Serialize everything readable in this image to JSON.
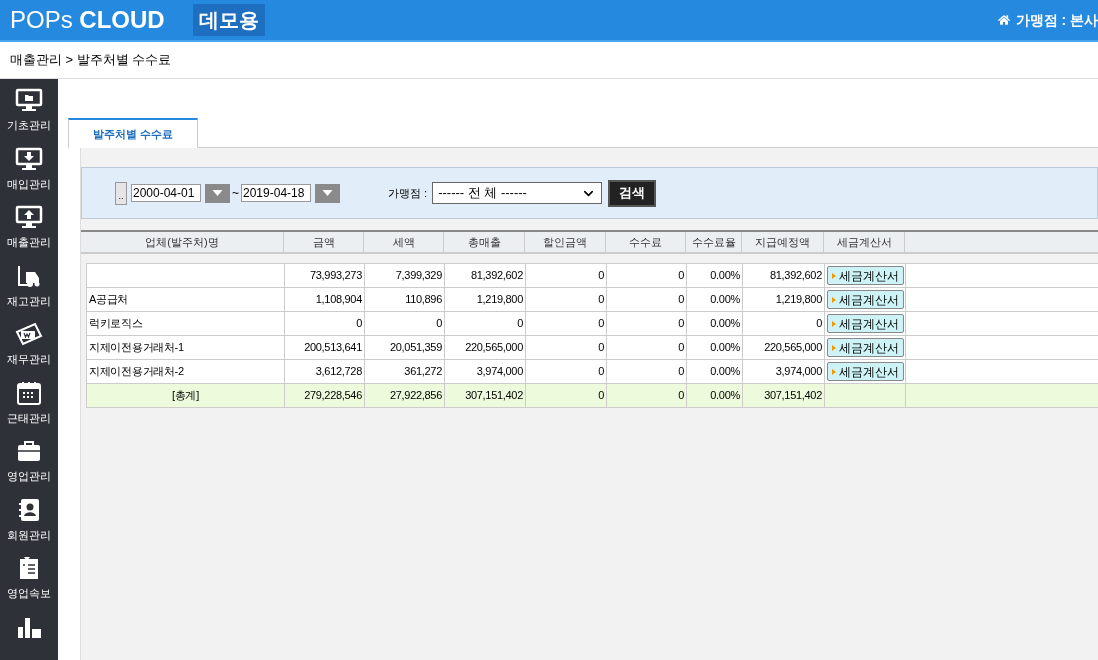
{
  "header": {
    "logo_light": "POPs",
    "logo_bold": "CLOUD",
    "badge": "데모용",
    "store_label": "가맹점 : 본사"
  },
  "breadcrumb": "매출관리 > 발주처별 수수료",
  "sidebar": [
    "기초관리",
    "매입관리",
    "매출관리",
    "재고관리",
    "재무관리",
    "근태관리",
    "영업관리",
    "회원관리",
    "영업속보"
  ],
  "tabs": [
    {
      "label": "발주처별 수수료",
      "selected": true
    }
  ],
  "search": {
    "picker_button": "..",
    "date_from": "2000-04-01",
    "separator": "~",
    "date_to": "2019-04-18",
    "store_label": "가맹점 :",
    "store_value": "------ 전 체 ------",
    "search_button": "검색"
  },
  "table": {
    "columns": [
      "업체(발주처)명",
      "금액",
      "세액",
      "총매출",
      "할인금액",
      "수수료",
      "수수료율",
      "지급예정액",
      "세금계산서"
    ],
    "rows": [
      {
        "kind": "row",
        "cells": [
          "",
          "73,993,273",
          "7,399,329",
          "81,392,602",
          "0",
          "0",
          "0.00%",
          "81,392,602"
        ],
        "invoice": "세금계산서"
      },
      {
        "kind": "row",
        "cells": [
          "A공급처",
          "1,108,904",
          "110,896",
          "1,219,800",
          "0",
          "0",
          "0.00%",
          "1,219,800"
        ],
        "invoice": "세금계산서"
      },
      {
        "kind": "row",
        "cells": [
          "럭키로직스",
          "0",
          "0",
          "0",
          "0",
          "0",
          "0.00%",
          "0"
        ],
        "invoice": "세금계산서"
      },
      {
        "kind": "row",
        "cells": [
          "지제이전용거래처-1",
          "200,513,641",
          "20,051,359",
          "220,565,000",
          "0",
          "0",
          "0.00%",
          "220,565,000"
        ],
        "invoice": "세금계산서"
      },
      {
        "kind": "row",
        "cells": [
          "지제이전용거래처-2",
          "3,612,728",
          "361,272",
          "3,974,000",
          "0",
          "0",
          "0.00%",
          "3,974,000"
        ],
        "invoice": "세금계산서"
      },
      {
        "kind": "total",
        "cells": [
          "[총계]",
          "279,228,546",
          "27,922,856",
          "307,151,402",
          "0",
          "0",
          "0.00%",
          "307,151,402"
        ]
      }
    ]
  }
}
